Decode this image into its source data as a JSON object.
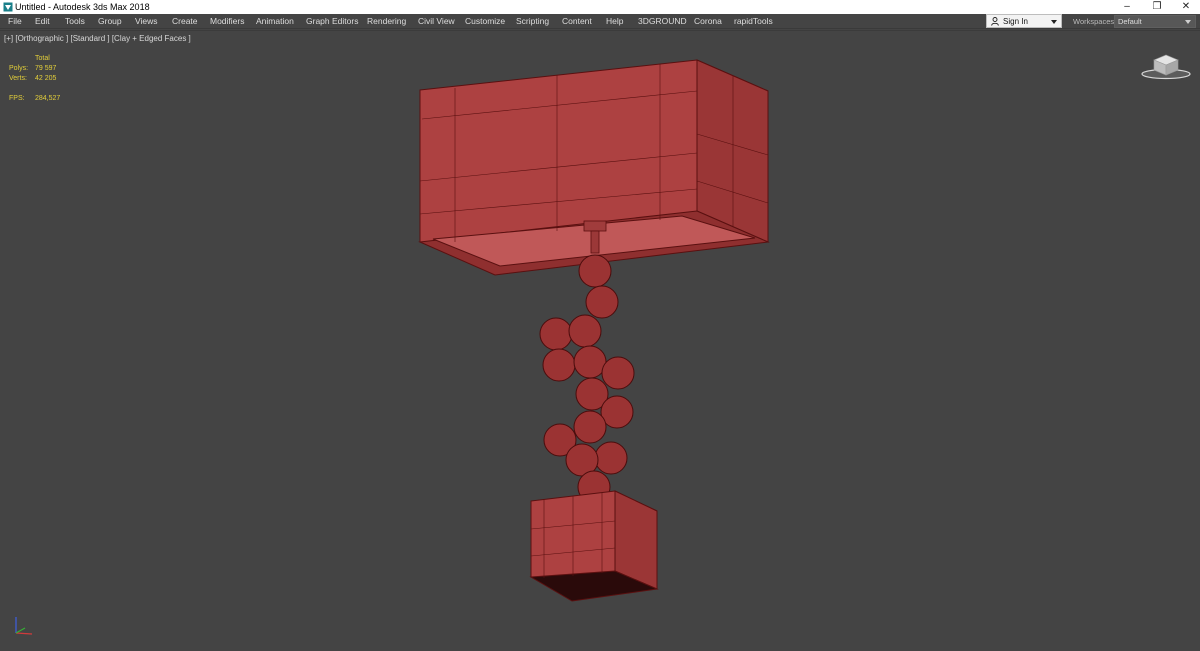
{
  "window": {
    "title": "Untitled - Autodesk 3ds Max 2018",
    "minimize_glyph": "–",
    "maximize_glyph": "❐",
    "close_glyph": "✕"
  },
  "menubar": {
    "items": [
      "File",
      "Edit",
      "Tools",
      "Group",
      "Views",
      "Create",
      "Modifiers",
      "Animation",
      "Graph Editors",
      "Rendering",
      "Civil View",
      "Customize",
      "Scripting",
      "Content",
      "Help",
      "3DGROUND",
      "Corona",
      "rapidTools"
    ]
  },
  "account": {
    "signin_label": "Sign In",
    "workspaces_label": "Workspaces:",
    "workspace_value": "Default"
  },
  "viewport": {
    "label": "[+] [Orthographic ] [Standard ] [Clay + Edged Faces ]",
    "stats": {
      "header": "Total",
      "polys_label": "Polys:",
      "polys_value": "79 597",
      "verts_label": "Verts:",
      "verts_value": "42 205",
      "fps_label": "FPS:",
      "fps_value": "284,527"
    }
  },
  "icons": {
    "app": "3ds-max-app-icon",
    "user": "user-icon",
    "viewcube": "viewcube-icon",
    "axis": "axis-tripod-icon"
  },
  "colors": {
    "viewport_bg": "#444444",
    "clay": "#b04646",
    "edge": "#5a1010",
    "stats_text": "#e3cf3a"
  }
}
